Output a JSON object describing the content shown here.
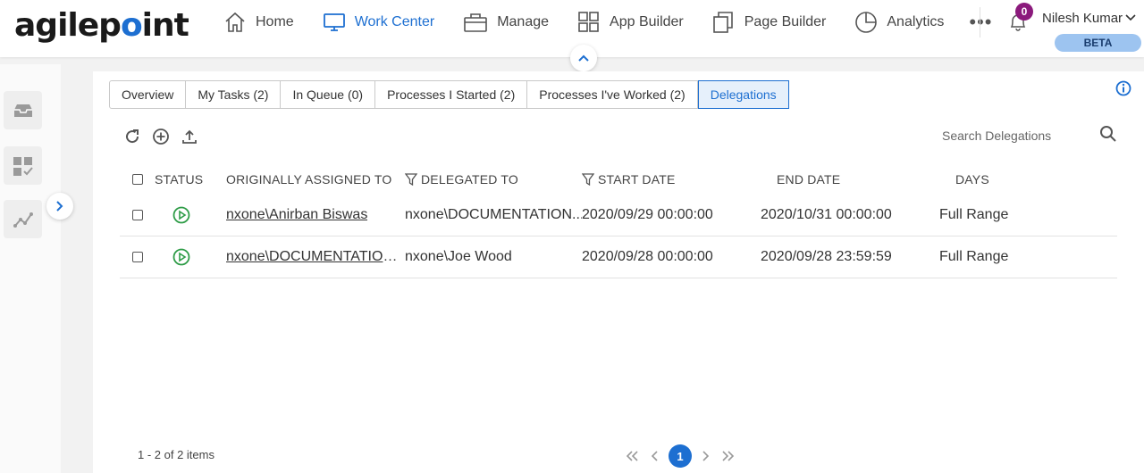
{
  "brand": {
    "logo_prefix": "agilep",
    "logo_dot": "o",
    "logo_suffix": "int"
  },
  "nav": {
    "items": [
      {
        "label": "Home",
        "icon": "home-icon"
      },
      {
        "label": "Work Center",
        "icon": "monitor-icon",
        "active": true
      },
      {
        "label": "Manage",
        "icon": "briefcase-icon"
      },
      {
        "label": "App Builder",
        "icon": "grid-icon"
      },
      {
        "label": "Page Builder",
        "icon": "pages-icon"
      },
      {
        "label": "Analytics",
        "icon": "pie-chart-icon"
      }
    ],
    "more": "•••"
  },
  "user": {
    "name": "Nilesh Kumar",
    "notifications": "0",
    "badge": "BETA"
  },
  "accent": "#1d6fd1",
  "tabs": [
    {
      "label": "Overview"
    },
    {
      "label": "My Tasks (2)"
    },
    {
      "label": "In Queue (0)"
    },
    {
      "label": "Processes I Started (2)"
    },
    {
      "label": "Processes I've Worked (2)"
    },
    {
      "label": "Delegations",
      "active": true
    }
  ],
  "search": {
    "placeholder": "Search Delegations"
  },
  "table": {
    "headers": {
      "status": "STATUS",
      "originally_assigned_to": "ORIGINALLY ASSIGNED TO",
      "delegated_to": "DELEGATED TO",
      "start_date": "START DATE",
      "end_date": "END DATE",
      "days": "DAYS"
    },
    "rows": [
      {
        "originally_assigned_to": "nxone\\Anirban Biswas",
        "delegated_to": "nxone\\DOCUMENTATION...",
        "start_date": "2020/09/29 00:00:00",
        "end_date": "2020/10/31 00:00:00",
        "days": "Full Range"
      },
      {
        "originally_assigned_to": "nxone\\DOCUMENTATION...",
        "delegated_to": "nxone\\Joe Wood",
        "start_date": "2020/09/28 00:00:00",
        "end_date": "2020/09/28 23:59:59",
        "days": "Full Range"
      }
    ]
  },
  "footer": {
    "items_count": "1 - 2 of 2 items",
    "current_page": "1"
  }
}
